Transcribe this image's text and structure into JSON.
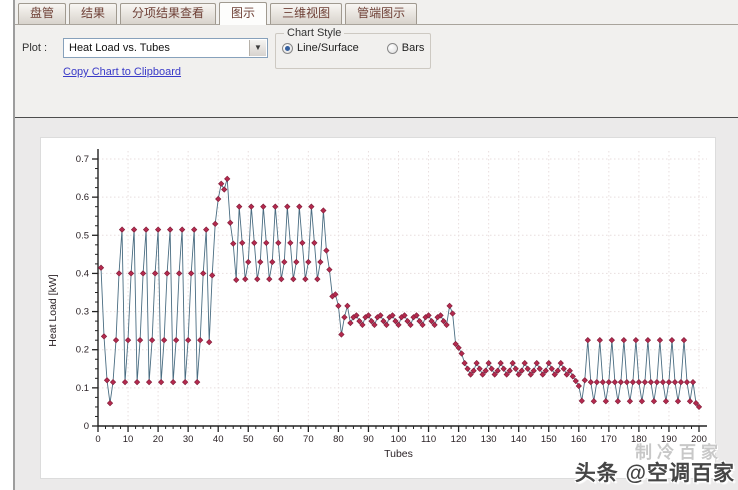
{
  "tabs": [
    {
      "label": "盘管",
      "active": false
    },
    {
      "label": "结果",
      "active": false
    },
    {
      "label": "分项结果查看",
      "active": false
    },
    {
      "label": "图示",
      "active": true
    },
    {
      "label": "三维视图",
      "active": false
    },
    {
      "label": "管端图示",
      "active": false
    }
  ],
  "toolbar": {
    "plot_label": "Plot :",
    "plot_value": "Heat Load vs. Tubes",
    "dropdown_icon": "▼",
    "copy_link": "Copy Chart to Clipboard",
    "chart_style": {
      "title": "Chart Style",
      "options": [
        {
          "label": "Line/Surface",
          "selected": true
        },
        {
          "label": "Bars",
          "selected": false
        }
      ]
    }
  },
  "chart_data": {
    "type": "line",
    "title": "",
    "xlabel": "Tubes",
    "ylabel": "Heat Load [kW]",
    "xlim": [
      0,
      200
    ],
    "ylim": [
      0,
      0.7
    ],
    "x_major_tick": 10,
    "x_minor_tick": 2.5,
    "y_major_tick": 0.1,
    "y_minor_tick": 0.025,
    "grid": true,
    "legend": "none",
    "marker": "diamond",
    "colors": {
      "marker": "#b42a4e",
      "marker_edge": "#7e1c38",
      "line": "#4a6d82",
      "grid": "#e8dede",
      "axis": "#222222"
    },
    "x_is_index_from": 1,
    "values": [
      0.415,
      0.235,
      0.12,
      0.06,
      0.115,
      0.225,
      0.4,
      0.515,
      0.115,
      0.225,
      0.4,
      0.515,
      0.115,
      0.225,
      0.4,
      0.515,
      0.115,
      0.225,
      0.4,
      0.515,
      0.115,
      0.225,
      0.4,
      0.515,
      0.115,
      0.225,
      0.4,
      0.515,
      0.115,
      0.225,
      0.4,
      0.515,
      0.115,
      0.225,
      0.4,
      0.515,
      0.22,
      0.395,
      0.53,
      0.595,
      0.635,
      0.62,
      0.648,
      0.533,
      0.478,
      0.383,
      0.575,
      0.48,
      0.385,
      0.43,
      0.575,
      0.48,
      0.385,
      0.43,
      0.575,
      0.48,
      0.385,
      0.43,
      0.575,
      0.48,
      0.385,
      0.43,
      0.575,
      0.48,
      0.385,
      0.43,
      0.575,
      0.48,
      0.385,
      0.43,
      0.575,
      0.48,
      0.385,
      0.43,
      0.565,
      0.46,
      0.41,
      0.34,
      0.345,
      0.315,
      0.24,
      0.285,
      0.315,
      0.27,
      0.285,
      0.29,
      0.275,
      0.265,
      0.285,
      0.29,
      0.275,
      0.265,
      0.285,
      0.29,
      0.275,
      0.265,
      0.285,
      0.29,
      0.275,
      0.265,
      0.285,
      0.29,
      0.275,
      0.265,
      0.285,
      0.29,
      0.275,
      0.265,
      0.285,
      0.29,
      0.275,
      0.265,
      0.285,
      0.29,
      0.275,
      0.265,
      0.315,
      0.295,
      0.215,
      0.205,
      0.19,
      0.165,
      0.15,
      0.135,
      0.145,
      0.165,
      0.15,
      0.135,
      0.145,
      0.165,
      0.15,
      0.135,
      0.145,
      0.165,
      0.15,
      0.135,
      0.145,
      0.165,
      0.15,
      0.135,
      0.145,
      0.165,
      0.15,
      0.135,
      0.145,
      0.165,
      0.15,
      0.135,
      0.145,
      0.165,
      0.15,
      0.135,
      0.145,
      0.165,
      0.15,
      0.135,
      0.145,
      0.13,
      0.118,
      0.105,
      0.066,
      0.12,
      0.225,
      0.115,
      0.065,
      0.115,
      0.225,
      0.115,
      0.065,
      0.115,
      0.225,
      0.115,
      0.065,
      0.115,
      0.225,
      0.115,
      0.065,
      0.115,
      0.225,
      0.115,
      0.065,
      0.115,
      0.225,
      0.115,
      0.065,
      0.115,
      0.225,
      0.115,
      0.065,
      0.115,
      0.225,
      0.115,
      0.065,
      0.115,
      0.225,
      0.115,
      0.065,
      0.115,
      0.06,
      0.05
    ]
  },
  "watermark": {
    "ghost": "制冷百家",
    "text": "头条 @空调百家"
  }
}
